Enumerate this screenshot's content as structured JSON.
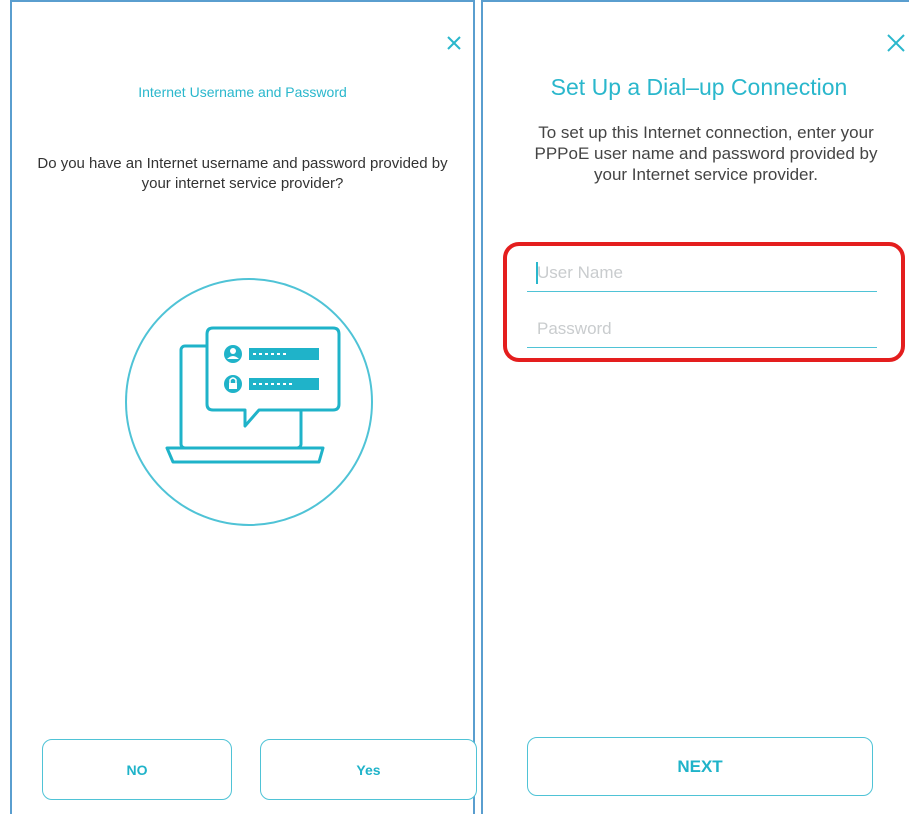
{
  "left_screen": {
    "title": "Internet Username and Password",
    "question": "Do you have an Internet username and password provided by your internet service provider?",
    "illustration_icon": "credentials-laptop-icon",
    "buttons": {
      "no_label": "NO",
      "yes_label": "Yes"
    }
  },
  "right_screen": {
    "title": "Set Up a Dial–up Connection",
    "description": "To set up this Internet connection, enter your PPPoE user name and password provided by your Internet service provider.",
    "fields": {
      "username_placeholder": "User Name",
      "username_value": "",
      "password_placeholder": "Password",
      "password_value": ""
    },
    "next_label": "NEXT"
  },
  "colors": {
    "accent": "#2ab7cc",
    "button_border": "#4fc3d6",
    "highlight": "#e41e1e",
    "frame": "#5a9ecf"
  }
}
